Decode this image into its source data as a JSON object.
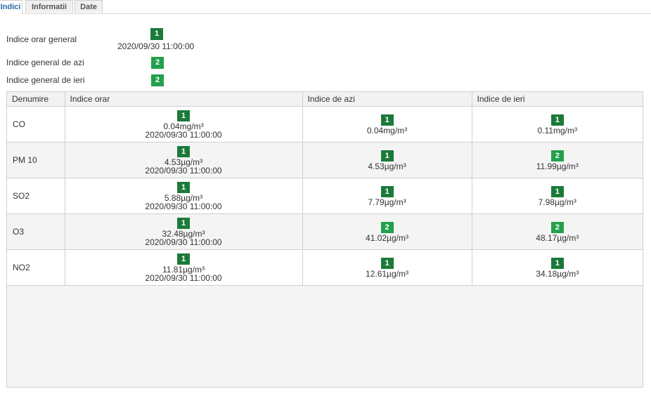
{
  "tabs": [
    {
      "label": "Indici"
    },
    {
      "label": "Informatii"
    },
    {
      "label": "Date"
    }
  ],
  "summary": {
    "hourly_label": "Indice orar general",
    "hourly_index": "1",
    "hourly_timestamp": "2020/09/30 11:00:00",
    "today_label": "Indice general de azi",
    "today_index": "2",
    "yesterday_label": "Indice general de ieri",
    "yesterday_index": "2"
  },
  "colors": {
    "index_1": "#1b7a3a",
    "index_2": "#22a04b"
  },
  "table": {
    "headers": [
      "Denumire",
      "Indice orar",
      "Indice de azi",
      "Indice de ieri"
    ],
    "rows": [
      {
        "name": "CO",
        "hourly": {
          "index": "1",
          "value": "0.04mg/m³",
          "timestamp": "2020/09/30 11:00:00"
        },
        "today": {
          "index": "1",
          "value": "0.04mg/m³"
        },
        "yesterday": {
          "index": "1",
          "value": "0.11mg/m³"
        }
      },
      {
        "name": "PM 10",
        "hourly": {
          "index": "1",
          "value": "4.53µg/m³",
          "timestamp": "2020/09/30 11:00:00"
        },
        "today": {
          "index": "1",
          "value": "4.53µg/m³"
        },
        "yesterday": {
          "index": "2",
          "value": "11.99µg/m³"
        }
      },
      {
        "name": "SO2",
        "hourly": {
          "index": "1",
          "value": "5.88µg/m³",
          "timestamp": "2020/09/30 11:00:00"
        },
        "today": {
          "index": "1",
          "value": "7.79µg/m³"
        },
        "yesterday": {
          "index": "1",
          "value": "7.98µg/m³"
        }
      },
      {
        "name": "O3",
        "hourly": {
          "index": "1",
          "value": "32.48µg/m³",
          "timestamp": "2020/09/30 11:00:00"
        },
        "today": {
          "index": "2",
          "value": "41.02µg/m³"
        },
        "yesterday": {
          "index": "2",
          "value": "48.17µg/m³"
        }
      },
      {
        "name": "NO2",
        "hourly": {
          "index": "1",
          "value": "11.81µg/m³",
          "timestamp": "2020/09/30 11:00:00"
        },
        "today": {
          "index": "1",
          "value": "12.61µg/m³"
        },
        "yesterday": {
          "index": "1",
          "value": "34.18µg/m³"
        }
      }
    ]
  }
}
